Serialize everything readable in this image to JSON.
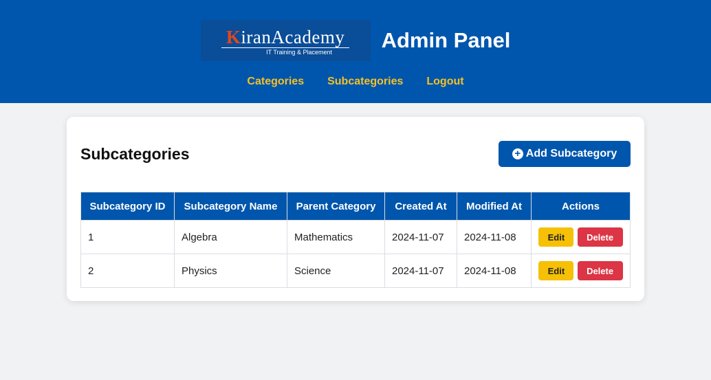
{
  "header": {
    "logo": {
      "main": "KiranAcademy",
      "tagline": "IT Training & Placement"
    },
    "title": "Admin Panel",
    "nav": [
      {
        "label": "Categories"
      },
      {
        "label": "Subcategories"
      },
      {
        "label": "Logout"
      }
    ]
  },
  "main": {
    "title": "Subcategories",
    "add_button": {
      "label": "Add Subcategory",
      "icon": "plus-circle-icon"
    },
    "table": {
      "columns": [
        "Subcategory ID",
        "Subcategory Name",
        "Parent Category",
        "Created At",
        "Modified At",
        "Actions"
      ],
      "rows": [
        {
          "id": "1",
          "name": "Algebra",
          "parent": "Mathematics",
          "created": "2024-11-07",
          "modified": "2024-11-08"
        },
        {
          "id": "2",
          "name": "Physics",
          "parent": "Science",
          "created": "2024-11-07",
          "modified": "2024-11-08"
        }
      ],
      "edit_label": "Edit",
      "delete_label": "Delete"
    }
  },
  "colors": {
    "primary": "#0056ad",
    "nav_link": "#f5c125",
    "edit": "#f5c006",
    "delete": "#dc3545",
    "logo_accent": "#e3471c"
  }
}
